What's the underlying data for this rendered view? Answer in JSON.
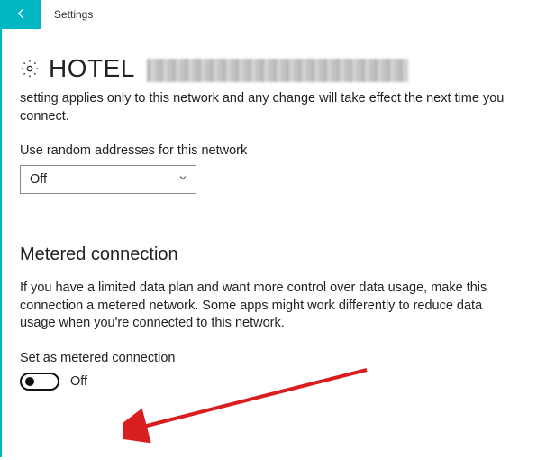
{
  "titlebar": {
    "title": "Settings"
  },
  "network": {
    "name": "HOTEL",
    "description": "setting applies only to this network and any change will take effect the next time you connect."
  },
  "random_addresses": {
    "label": "Use random addresses for this network",
    "selected": "Off"
  },
  "metered": {
    "heading": "Metered connection",
    "description": "If you have a limited data plan and want more control over data usage, make this connection a metered network. Some apps might work differently to reduce data usage when you're connected to this network.",
    "toggle_label": "Set as metered connection",
    "toggle_state": "Off"
  }
}
